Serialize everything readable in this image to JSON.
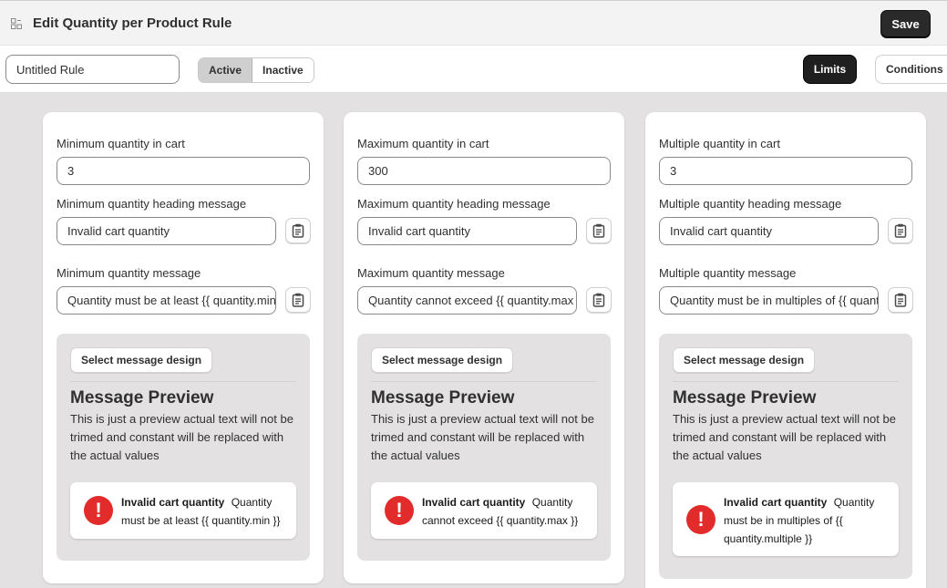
{
  "header": {
    "title": "Edit Quantity per Product Rule",
    "save_label": "Save"
  },
  "subbar": {
    "rule_name": "Untitled Rule",
    "status_options": [
      "Active",
      "Inactive"
    ],
    "selected_status": "Active",
    "tab_limits": "Limits",
    "tab_conditions": "Conditions"
  },
  "cards": [
    {
      "qty_label": "Minimum quantity in cart",
      "qty_value": "3",
      "heading_label": "Minimum quantity heading message",
      "heading_value": "Invalid cart quantity",
      "message_label": "Minimum quantity message",
      "message_value": "Quantity must be at least {{ quantity.min }}",
      "design_button": "Select message design",
      "preview_title": "Message Preview",
      "preview_desc": "This is just a preview actual text will not be trimed and constant will be replaced with the actual values",
      "preview_heading": "Invalid cart quantity",
      "preview_message": "Quantity must be at least {{ quantity.min }}"
    },
    {
      "qty_label": "Maximum quantity in cart",
      "qty_value": "300",
      "heading_label": "Maximum quantity heading message",
      "heading_value": "Invalid cart quantity",
      "message_label": "Maximum quantity message",
      "message_value": "Quantity cannot exceed {{ quantity.max }}",
      "design_button": "Select message design",
      "preview_title": "Message Preview",
      "preview_desc": "This is just a preview actual text will not be trimed and constant will be replaced with the actual values",
      "preview_heading": "Invalid cart quantity",
      "preview_message": "Quantity cannot exceed {{ quantity.max }}"
    },
    {
      "qty_label": "Multiple quantity in cart",
      "qty_value": "3",
      "heading_label": "Multiple quantity heading message",
      "heading_value": "Invalid cart quantity",
      "message_label": "Multiple quantity message",
      "message_value": "Quantity must be in multiples of {{ quantity.multiple }}",
      "design_button": "Select message design",
      "preview_title": "Message Preview",
      "preview_desc": "This is just a preview actual text will not be trimed and constant will be replaced with the actual values",
      "preview_heading": "Invalid cart quantity",
      "preview_message": "Quantity must be in multiples of {{ quantity.multiple }}"
    }
  ],
  "colors": {
    "error_icon": "#e22c2c",
    "primary_button": "#2a2a2a",
    "canvas": "#e3e1e1"
  },
  "icons": {
    "app": "grid-icon",
    "clipboard": "clipboard-icon",
    "error": "exclamation-icon",
    "error_glyph": "!"
  }
}
